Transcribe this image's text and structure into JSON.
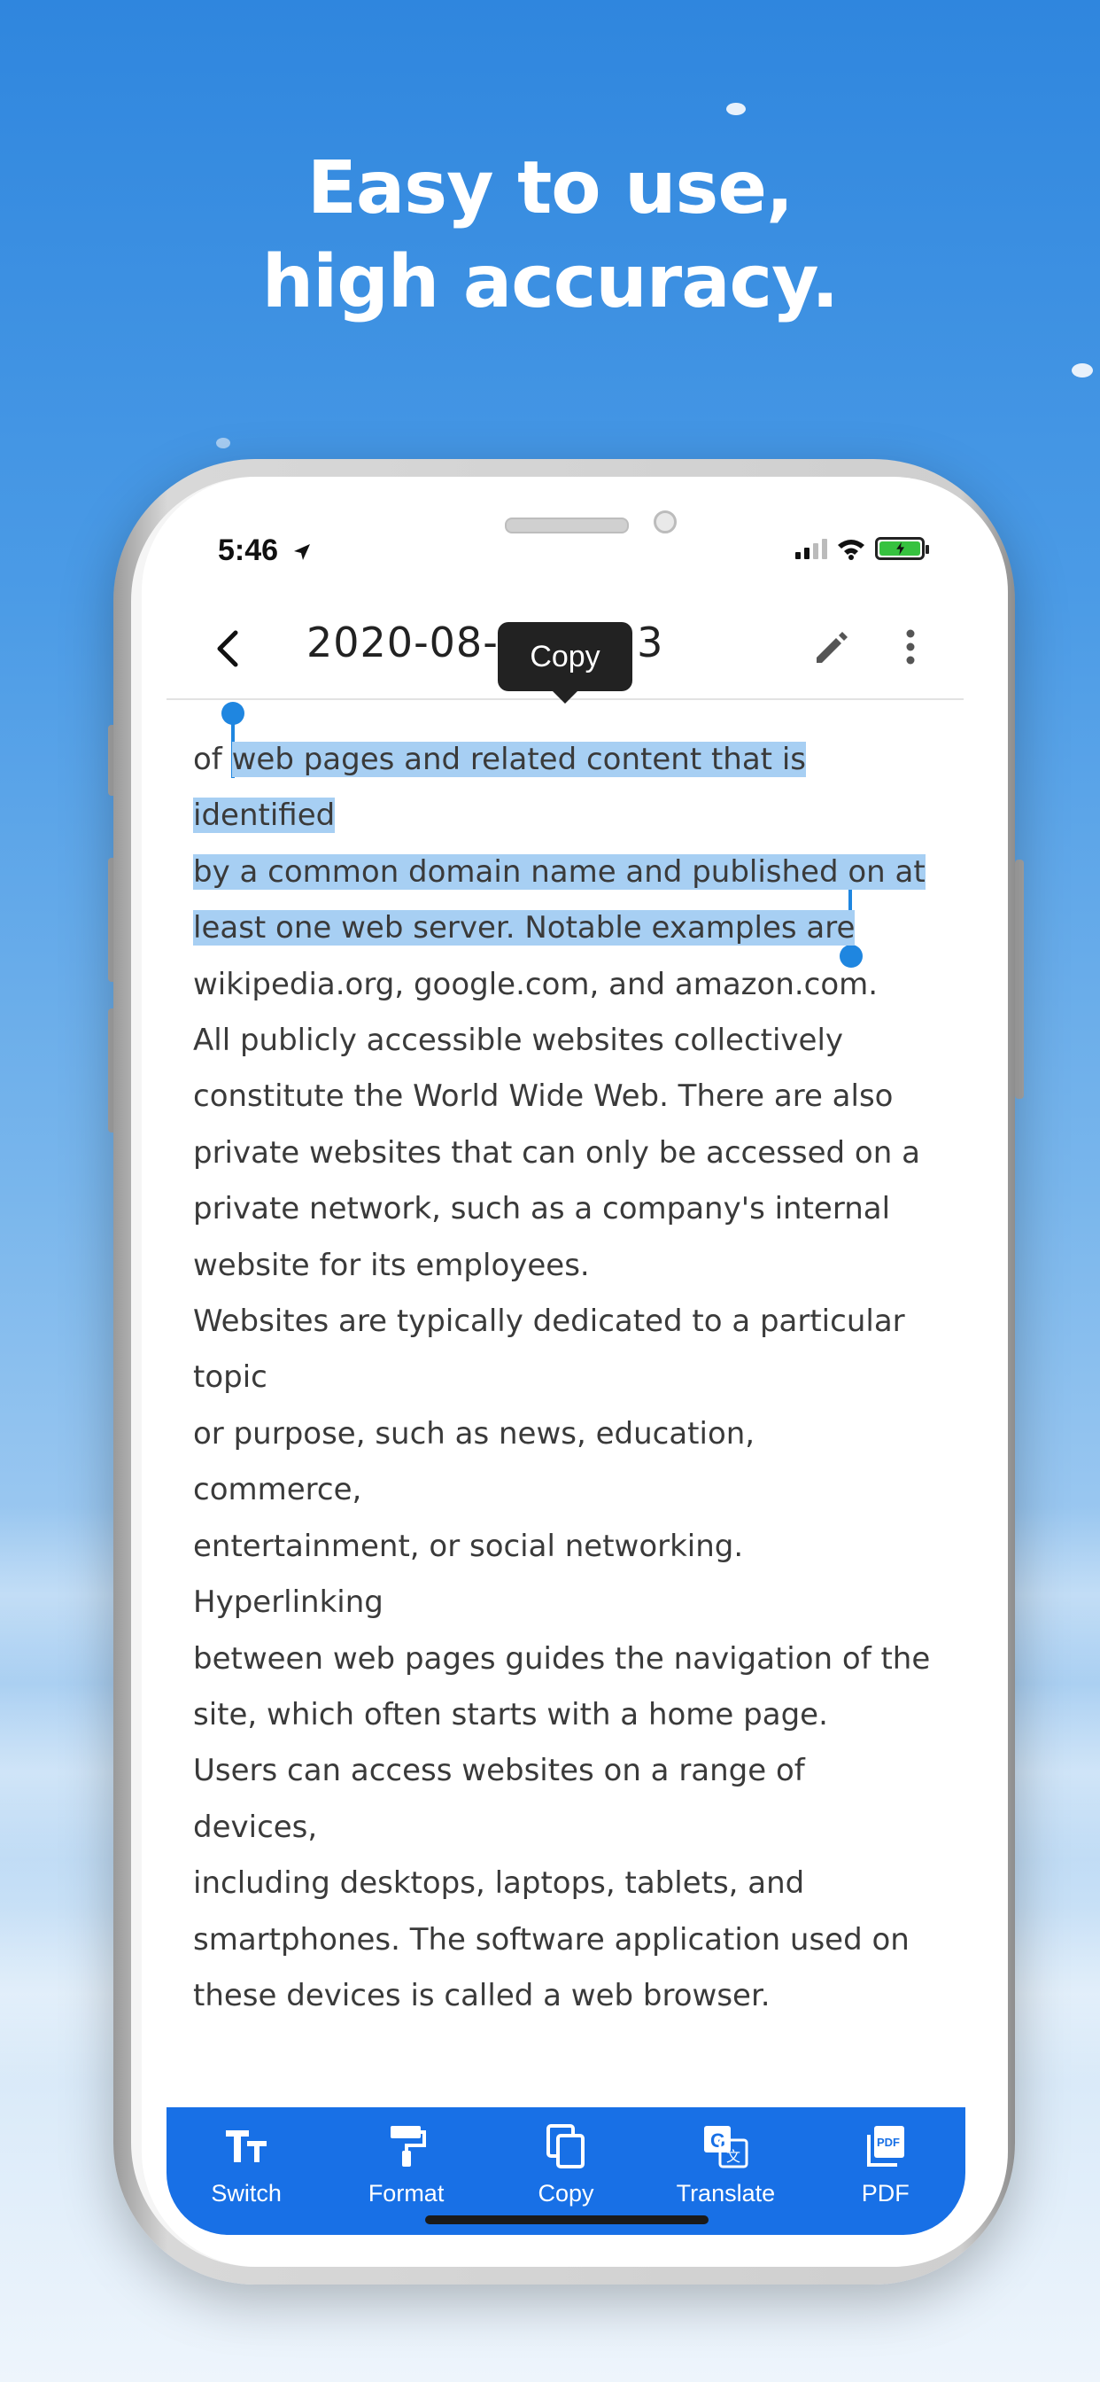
{
  "headline": {
    "line1": "Easy to use,",
    "line2": "high accuracy."
  },
  "status_bar": {
    "time": "5:46"
  },
  "app_bar": {
    "title": "2020-08-2",
    "title_tail": "3"
  },
  "tooltip": {
    "label": "Copy"
  },
  "document": {
    "lines": [
      {
        "pre": "of ",
        "hl": "web pages and related content that is",
        "post": ""
      },
      {
        "pre": "",
        "hl": "identified",
        "post": ""
      },
      {
        "pre": "",
        "hl": "by a common domain name and published on at",
        "post": ""
      },
      {
        "pre": "",
        "hl": "least one web server. Notable examples are",
        "post": ""
      },
      {
        "pre": "wikipedia.org, google.com, and amazon.com.",
        "hl": "",
        "post": ""
      },
      {
        "pre": "All publicly accessible websites collectively",
        "hl": "",
        "post": ""
      },
      {
        "pre": "constitute the World Wide Web. There are also",
        "hl": "",
        "post": ""
      },
      {
        "pre": "private websites that can only be accessed on a",
        "hl": "",
        "post": ""
      },
      {
        "pre": "private network, such as a company's internal",
        "hl": "",
        "post": ""
      },
      {
        "pre": "website for its employees.",
        "hl": "",
        "post": ""
      },
      {
        "pre": "Websites are typically dedicated to a particular",
        "hl": "",
        "post": ""
      },
      {
        "pre": "topic",
        "hl": "",
        "post": ""
      },
      {
        "pre": "or purpose, such as news, education,",
        "hl": "",
        "post": ""
      },
      {
        "pre": "commerce,",
        "hl": "",
        "post": ""
      },
      {
        "pre": "entertainment, or social networking.",
        "hl": "",
        "post": ""
      },
      {
        "pre": "Hyperlinking",
        "hl": "",
        "post": ""
      },
      {
        "pre": "between web pages guides the navigation of the",
        "hl": "",
        "post": ""
      },
      {
        "pre": "site, which often starts with a home page.",
        "hl": "",
        "post": ""
      },
      {
        "pre": "Users can access websites on a range of",
        "hl": "",
        "post": ""
      },
      {
        "pre": "devices,",
        "hl": "",
        "post": ""
      },
      {
        "pre": "including desktops, laptops, tablets, and",
        "hl": "",
        "post": ""
      },
      {
        "pre": "smartphones. The software application used on",
        "hl": "",
        "post": ""
      },
      {
        "pre": "these devices is called a web browser.",
        "hl": "",
        "post": ""
      }
    ]
  },
  "toolbar": {
    "items": [
      {
        "label": "Switch",
        "icon": "text-size-icon"
      },
      {
        "label": "Format",
        "icon": "paint-roller-icon"
      },
      {
        "label": "Copy",
        "icon": "copy-icon"
      },
      {
        "label": "Translate",
        "icon": "translate-icon"
      },
      {
        "label": "PDF",
        "icon": "pdf-icon"
      }
    ]
  },
  "colors": {
    "accent": "#1870e6",
    "selection": "#a7cff3",
    "handle": "#1f86e0",
    "battery": "#36c23f"
  }
}
